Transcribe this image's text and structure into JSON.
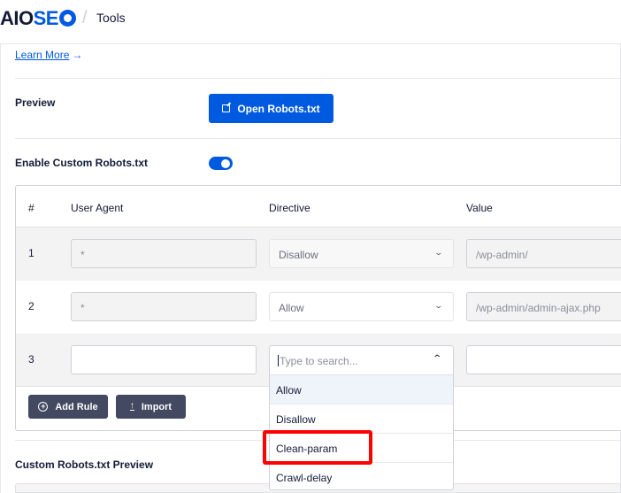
{
  "header": {
    "logo_part1": "AIO",
    "logo_part2": "SE",
    "separator": "/",
    "breadcrumb": "Tools"
  },
  "learn_more": {
    "label": "Learn More",
    "arrow": "→"
  },
  "preview": {
    "label": "Preview",
    "button_label": "Open Robots.txt"
  },
  "enable_custom": {
    "label": "Enable Custom Robots.txt",
    "enabled": true
  },
  "rules_table": {
    "columns": [
      "#",
      "User Agent",
      "Directive",
      "Value"
    ],
    "rows": [
      {
        "num": "1",
        "user_agent": "*",
        "directive": "Disallow",
        "value": "/wp-admin/"
      },
      {
        "num": "2",
        "user_agent": "*",
        "directive": "Allow",
        "value": "/wp-admin/admin-ajax.php"
      },
      {
        "num": "3",
        "user_agent": "",
        "directive": "",
        "value": ""
      }
    ],
    "add_rule_label": "Add Rule",
    "import_label": "Import"
  },
  "directive_dropdown": {
    "placeholder": "Type to search...",
    "options": [
      "Allow",
      "Disallow",
      "Clean-param",
      "Crawl-delay"
    ],
    "highlighted_option": "Allow",
    "annotated_option": "Clean-param"
  },
  "custom_preview": {
    "label": "Custom Robots.txt Preview"
  },
  "colors": {
    "brand_blue": "#005ae0",
    "dark_button": "#434960",
    "annotation_red": "#ff0000"
  }
}
